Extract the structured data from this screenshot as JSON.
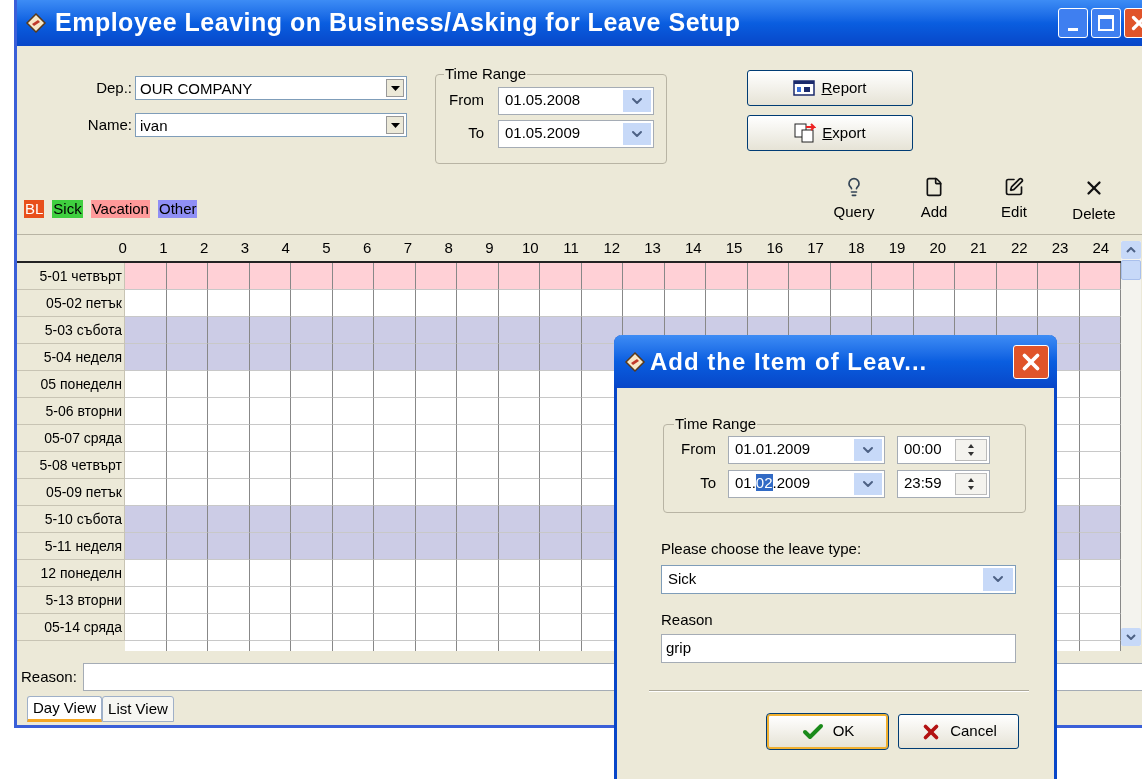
{
  "window": {
    "title": "Employee Leaving on Business/Asking for Leave Setup"
  },
  "filters": {
    "dep_label": "Dep.:",
    "dep_value": "OUR COMPANY",
    "name_label": "Name:",
    "name_value": "ivan"
  },
  "time_range": {
    "legend": "Time Range",
    "from_label": "From",
    "from_value": "01.05.2008",
    "to_label": "To",
    "to_value": "01.05.2009"
  },
  "buttons": [
    {
      "label": "Report",
      "kind": "report"
    },
    {
      "label": "Export",
      "kind": "export"
    }
  ],
  "legend": [
    {
      "label": "BL",
      "color": "#e8501c"
    },
    {
      "label": "Sick",
      "color": "#3fcf3f"
    },
    {
      "label": "Vacation",
      "color": "#ff9a9a"
    },
    {
      "label": "Other",
      "color": "#8f8ff5"
    }
  ],
  "toolbar": [
    {
      "label": "Query",
      "kind": "query"
    },
    {
      "label": "Add",
      "kind": "add"
    },
    {
      "label": "Edit",
      "kind": "edit"
    },
    {
      "label": "Delete",
      "kind": "delete"
    }
  ],
  "hours": [
    "0",
    "1",
    "2",
    "3",
    "4",
    "5",
    "6",
    "7",
    "8",
    "9",
    "10",
    "11",
    "12",
    "13",
    "14",
    "15",
    "16",
    "17",
    "18",
    "19",
    "20",
    "21",
    "22",
    "23",
    "24"
  ],
  "rows": [
    {
      "label": "5-01 четвърт",
      "color": "#ffd0d6"
    },
    {
      "label": "05-02 петък",
      "color": "#ffffff"
    },
    {
      "label": "5-03 събота",
      "color": "#ccccE6"
    },
    {
      "label": "5-04 неделя",
      "color": "#cccce6"
    },
    {
      "label": "05 понеделн",
      "color": "#ffffff"
    },
    {
      "label": "5-06 вторни",
      "color": "#ffffff"
    },
    {
      "label": "05-07 сряда",
      "color": "#ffffff"
    },
    {
      "label": "5-08 четвърт",
      "color": "#ffffff"
    },
    {
      "label": "05-09 петък",
      "color": "#ffffff"
    },
    {
      "label": "5-10 събота",
      "color": "#cccce6"
    },
    {
      "label": "5-11 неделя",
      "color": "#cccce6"
    },
    {
      "label": "12 понеделн",
      "color": "#ffffff"
    },
    {
      "label": "5-13 вторни",
      "color": "#ffffff"
    },
    {
      "label": "05-14 сряда",
      "color": "#ffffff"
    }
  ],
  "reason": {
    "label": "Reason:"
  },
  "tabs": [
    {
      "label": "Day View",
      "selected": true
    },
    {
      "label": "List View",
      "selected": false
    }
  ],
  "dialog": {
    "title": "Add the Item of Leav...",
    "group_legend": "Time Range",
    "from_label": "From",
    "from_date": [
      {
        "text": "01.01.2009",
        "selected": false
      }
    ],
    "from_time": "00:00",
    "to_label": "To",
    "to_date": [
      {
        "text": "01.",
        "selected": false
      },
      {
        "text": "02",
        "selected": true
      },
      {
        "text": ".2009",
        "selected": false
      }
    ],
    "to_time": "23:59",
    "type_label": "Please choose the leave type:",
    "type_value": "Sick",
    "reason_label": "Reason",
    "reason_value": "grip",
    "buttons": [
      {
        "label": "OK",
        "kind": "ok",
        "default": true
      },
      {
        "label": "Cancel",
        "kind": "cancel",
        "default": false
      }
    ]
  }
}
